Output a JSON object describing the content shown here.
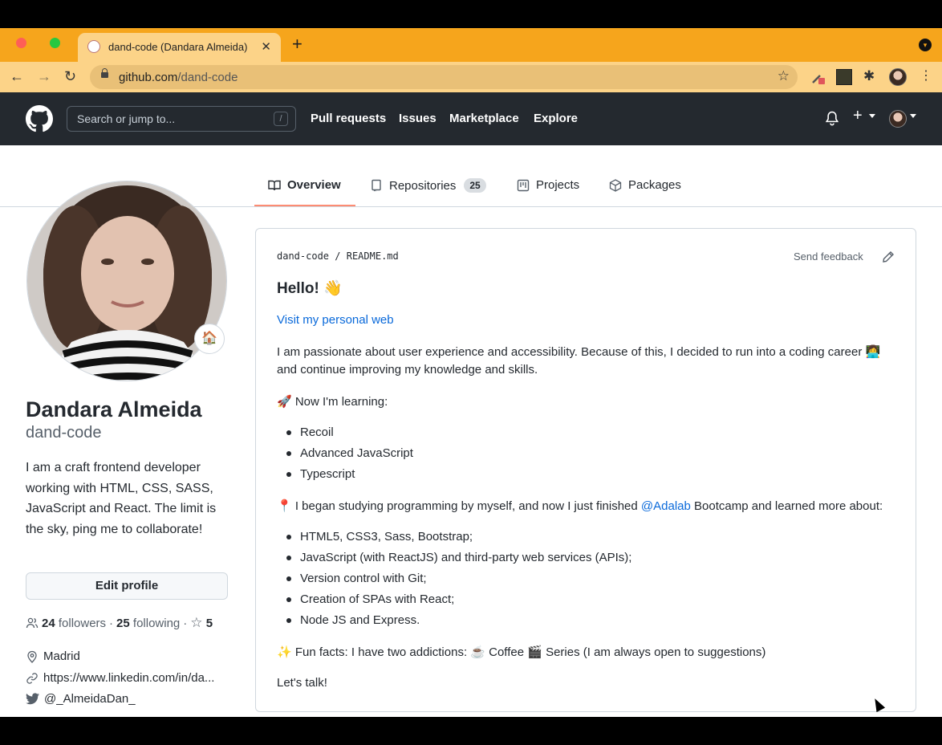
{
  "browser": {
    "tab_title": "dand-code (Dandara Almeida)",
    "tab_close": "✕",
    "new_tab": "+",
    "url_host": "github.com",
    "url_path": "/dand-code",
    "icons": [
      "back-icon",
      "forward-icon",
      "reload-icon",
      "lock-icon",
      "star-icon",
      "extensions-icon",
      "menu-icon"
    ]
  },
  "header": {
    "search_placeholder": "Search or jump to...",
    "search_shortcut": "/",
    "nav": [
      "Pull requests",
      "Issues",
      "Marketplace",
      "Explore"
    ]
  },
  "profile_tabs": [
    {
      "label": "Overview",
      "selected": true
    },
    {
      "label": "Repositories",
      "count": "25"
    },
    {
      "label": "Projects"
    },
    {
      "label": "Packages"
    }
  ],
  "profile": {
    "status_emoji": "🏠",
    "name": "Dandara Almeida",
    "login": "dand-code",
    "bio": "I am a craft frontend developer working with HTML, CSS, SASS, JavaScript and React. The limit is the sky, ping me to collaborate!",
    "edit_label": "Edit profile",
    "followers_count": "24",
    "followers_label": "followers",
    "following_count": "25",
    "following_label": "following",
    "sep": "·",
    "stars_count": "5",
    "location": "Madrid",
    "website": "https://www.linkedin.com/in/da...",
    "twitter": "@_AlmeidaDan_"
  },
  "readme": {
    "crumb_user": "dand-code",
    "crumb_sep": "/",
    "crumb_file": "README.md",
    "feedback": "Send feedback",
    "heading": "Hello! 👋",
    "link": "Visit my personal web",
    "para1_line1": "I am passionate about user experience and accessibility. Because of this, I decided to run into a coding career 👩‍💻",
    "para1_line2": "and continue improving my knowledge and skills.",
    "learning_title": "🚀 Now I'm learning:",
    "learning": [
      "Recoil",
      "Advanced JavaScript",
      "Typescript"
    ],
    "studying_pre": "📍 I began studying programming by myself, and now I just finished ",
    "studying_link": "@Adalab",
    "studying_post": " Bootcamp and learned more about:",
    "skills": [
      "HTML5, CSS3, Sass, Bootstrap;",
      "JavaScript (with ReactJS) and third-party web services (APIs);",
      "Version control with Git;",
      "Creation of SPAs with React;",
      "Node JS and Express."
    ],
    "fun_facts": "✨ Fun facts: I have two addictions: ☕ Coffee 🎬 Series (I am always open to suggestions)",
    "talk": "Let's talk!"
  }
}
